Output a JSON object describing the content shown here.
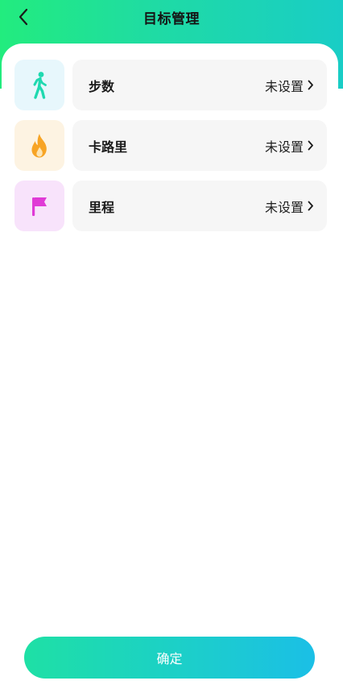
{
  "header": {
    "title": "目标管理",
    "back_icon": "chevron-left-icon"
  },
  "goals": [
    {
      "label": "步数",
      "value": "未设置",
      "icon": "walking-person-icon",
      "icon_color": "#1fd9b0",
      "icon_bg": "#e7f7fc"
    },
    {
      "label": "卡路里",
      "value": "未设置",
      "icon": "flame-icon",
      "icon_color": "#f7a425",
      "icon_bg": "#fdf3e2"
    },
    {
      "label": "里程",
      "value": "未设置",
      "icon": "flag-icon",
      "icon_color": "#e03ad6",
      "icon_bg": "#f8e3fb"
    }
  ],
  "confirm_label": "确定",
  "colors": {
    "header_gradient_start": "#22ec7e",
    "header_gradient_end": "#19cdc6",
    "button_gradient_start": "#1ee0a5",
    "button_gradient_end": "#1bbfe6"
  }
}
